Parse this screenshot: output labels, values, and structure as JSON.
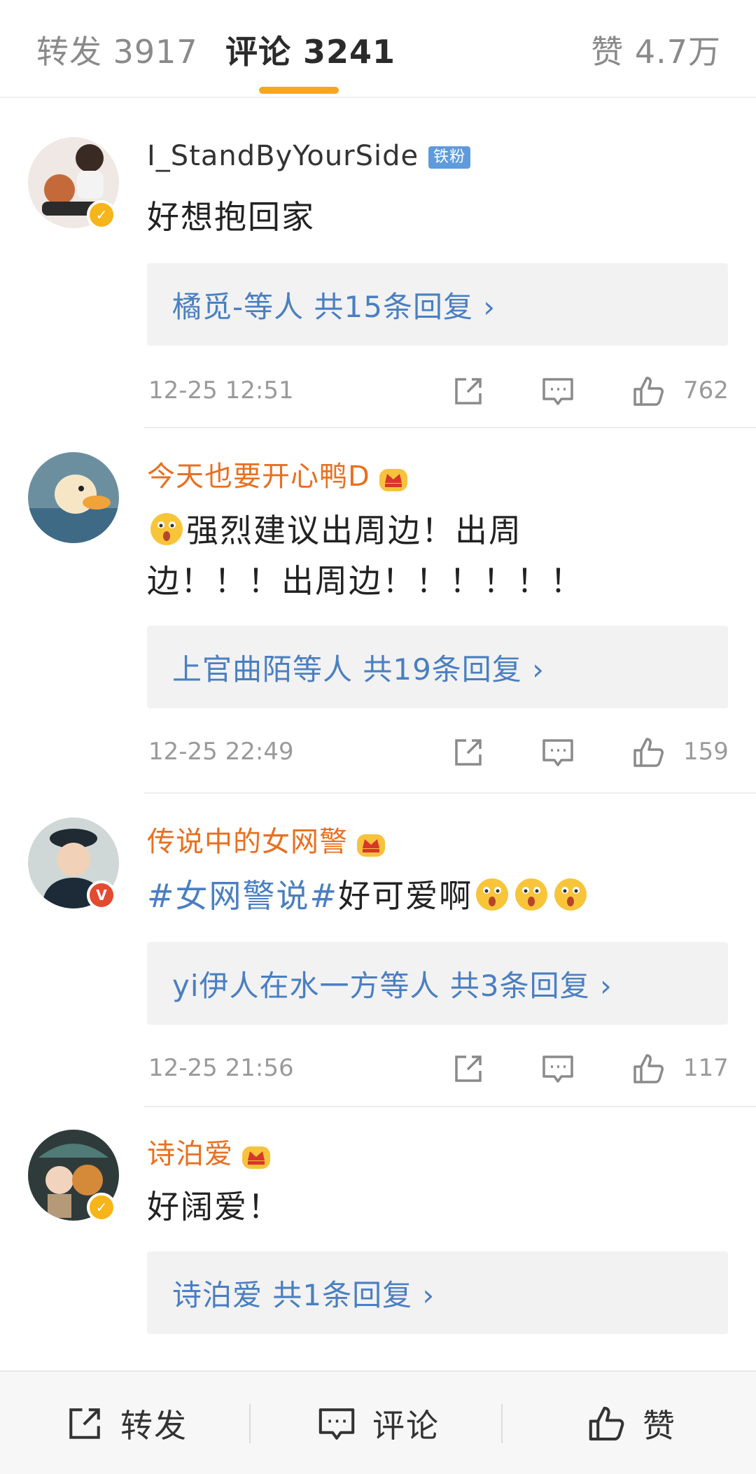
{
  "tabs": {
    "repost": "转发 3917",
    "comment": "评论 3241",
    "like": "赞 4.7万"
  },
  "comments": [
    {
      "username": "I_StandByYourSide",
      "badge": "铁粉",
      "text": "好想抱回家",
      "reply_summary": "橘觅-等人 共15条回复 ›",
      "time": "12-25 12:51",
      "likes": "762",
      "verified": "yellow"
    },
    {
      "username": "今天也要开心鸭D",
      "text": "强烈建议出周边！出周边！！！出周边！！！！！！",
      "reply_summary": "上官曲陌等人 共19条回复 ›",
      "time": "12-25 22:49",
      "likes": "159"
    },
    {
      "username": "传说中的女网警",
      "hashtag": "#女网警说#",
      "text": "好可爱啊",
      "reply_summary": "yi伊人在水一方等人 共3条回复 ›",
      "time": "12-25 21:56",
      "likes": "117",
      "verified": "red"
    },
    {
      "username": "诗泊爱",
      "text": "好阔爱！",
      "reply_summary": "诗泊爱 共1条回复 ›",
      "verified": "yellow"
    }
  ],
  "bottom_bar": {
    "repost": "转发",
    "comment": "评论",
    "like": "赞"
  },
  "colors": {
    "accent": "#f5a623",
    "link_blue": "#4a7fc1",
    "username_orange": "#e8701f",
    "verified_yellow": "#f6b518",
    "verified_red": "#e34b30"
  }
}
